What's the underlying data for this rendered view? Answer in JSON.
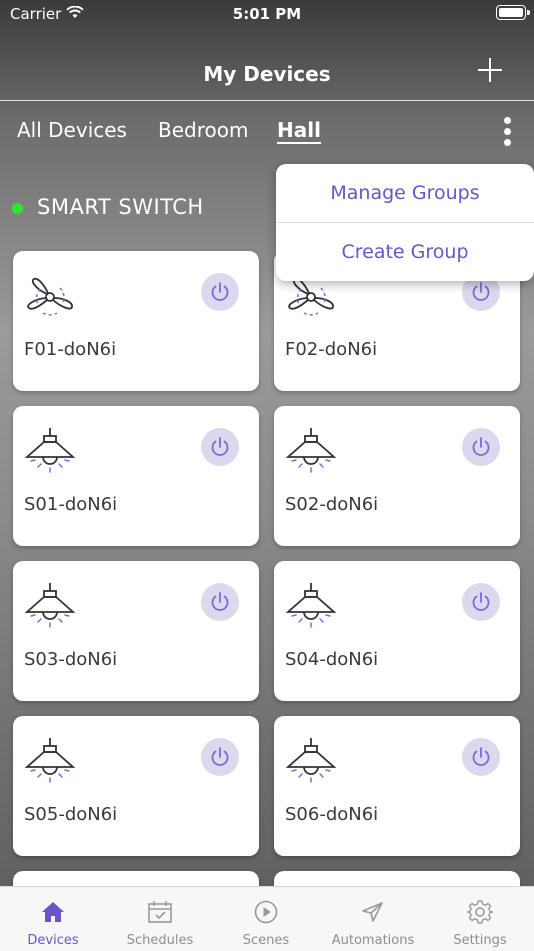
{
  "status_bar": {
    "carrier": "Carrier",
    "time": "5:01 PM"
  },
  "nav": {
    "title": "My Devices",
    "add_icon": "plus-icon"
  },
  "tabs": [
    {
      "label": "All Devices",
      "active": false
    },
    {
      "label": "Bedroom",
      "active": false
    },
    {
      "label": "Hall",
      "active": true
    }
  ],
  "section": {
    "title": "SMART SWITCH",
    "status_color": "#2ee62e"
  },
  "devices": [
    {
      "name": "F01-doN6i",
      "icon": "ceiling-fan-icon"
    },
    {
      "name": "F02-doN6i",
      "icon": "ceiling-fan-icon"
    },
    {
      "name": "S01-doN6i",
      "icon": "pendant-lamp-icon"
    },
    {
      "name": "S02-doN6i",
      "icon": "pendant-lamp-icon"
    },
    {
      "name": "S03-doN6i",
      "icon": "pendant-lamp-icon"
    },
    {
      "name": "S04-doN6i",
      "icon": "pendant-lamp-icon"
    },
    {
      "name": "S05-doN6i",
      "icon": "pendant-lamp-icon"
    },
    {
      "name": "S06-doN6i",
      "icon": "pendant-lamp-icon"
    }
  ],
  "menu": {
    "items": [
      "Manage Groups",
      "Create Group"
    ]
  },
  "tab_bar": {
    "items": [
      {
        "label": "Devices",
        "icon": "home-icon",
        "active": true
      },
      {
        "label": "Schedules",
        "icon": "calendar-icon",
        "active": false
      },
      {
        "label": "Scenes",
        "icon": "play-circle-icon",
        "active": false
      },
      {
        "label": "Automations",
        "icon": "send-icon",
        "active": false
      },
      {
        "label": "Settings",
        "icon": "gear-icon",
        "active": false
      }
    ]
  },
  "colors": {
    "accent": "#6a55c8",
    "power_bg": "#dcd8ee"
  }
}
